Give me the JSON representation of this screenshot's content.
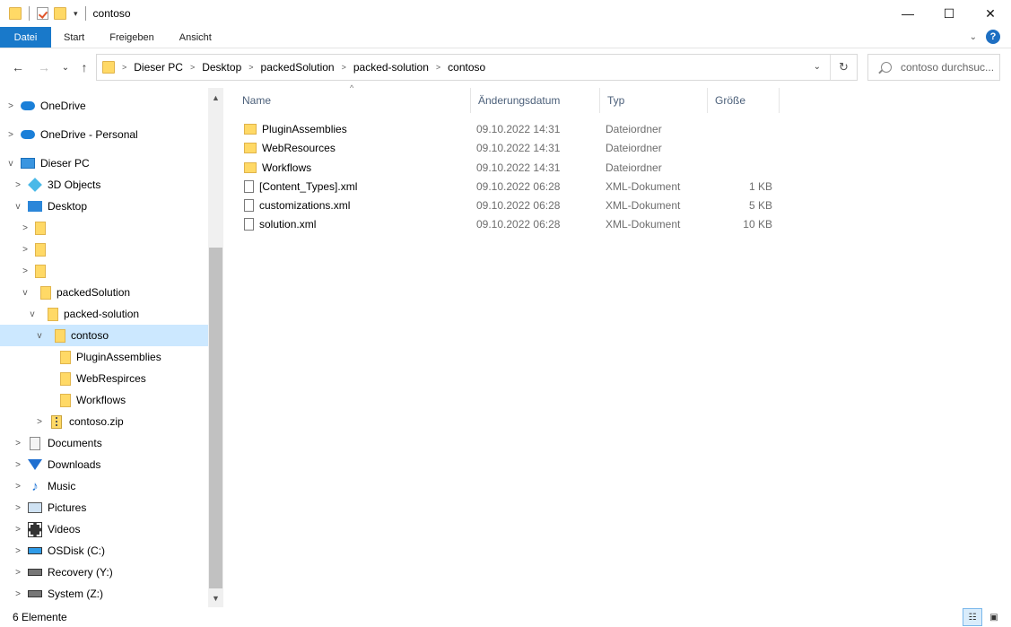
{
  "window": {
    "title": "contoso",
    "minimize_glyph": "—",
    "maximize_glyph": "☐",
    "close_glyph": "✕"
  },
  "ribbon": {
    "tabs": [
      "Datei",
      "Start",
      "Freigeben",
      "Ansicht"
    ],
    "collapse_glyph": "⌄",
    "help_label": "?"
  },
  "nav": {
    "back_glyph": "←",
    "forward_glyph": "→",
    "recent_glyph": "⌄",
    "up_glyph": "↑",
    "breadcrumb": [
      "Dieser PC",
      "Desktop",
      "packedSolution",
      "packed-solution",
      "contoso"
    ],
    "dropdown_glyph": "⌄",
    "refresh_glyph": "↻",
    "search_placeholder": "contoso durchsuc..."
  },
  "sidebar": {
    "items": [
      {
        "label": "OneDrive",
        "icon": "cloud-icon",
        "expand": ">"
      },
      {
        "label": "OneDrive - Personal",
        "icon": "cloud-icon",
        "expand": ">"
      },
      {
        "label": "Dieser PC",
        "icon": "computer-icon",
        "expand": "v"
      },
      {
        "label": "3D Objects",
        "icon": "cube-icon",
        "expand": ">"
      },
      {
        "label": "Desktop",
        "icon": "desktop-icon",
        "expand": "v"
      },
      {
        "label": "",
        "icon": "folder-icon",
        "expand": ">"
      },
      {
        "label": "",
        "icon": "folder-icon",
        "expand": ">"
      },
      {
        "label": "",
        "icon": "folder-icon",
        "expand": ">"
      },
      {
        "label": "packedSolution",
        "icon": "folder-icon",
        "expand": "v"
      },
      {
        "label": "packed-solution",
        "icon": "folder-icon",
        "expand": "v"
      },
      {
        "label": "contoso",
        "icon": "folder-icon",
        "expand": "v"
      },
      {
        "label": "PluginAssemblies",
        "icon": "folder-icon",
        "expand": ""
      },
      {
        "label": "WebRespirces",
        "icon": "folder-icon",
        "expand": ""
      },
      {
        "label": "Workflows",
        "icon": "folder-icon",
        "expand": ""
      },
      {
        "label": "contoso.zip",
        "icon": "zip-icon",
        "expand": ">"
      },
      {
        "label": "Documents",
        "icon": "documents-icon",
        "expand": ">"
      },
      {
        "label": "Downloads",
        "icon": "downloads-icon",
        "expand": ">"
      },
      {
        "label": "Music",
        "icon": "music-icon",
        "expand": ">"
      },
      {
        "label": "Pictures",
        "icon": "pictures-icon",
        "expand": ">"
      },
      {
        "label": "Videos",
        "icon": "videos-icon",
        "expand": ">"
      },
      {
        "label": "OSDisk (C:)",
        "icon": "drive-icon",
        "expand": ">"
      },
      {
        "label": "Recovery (Y:)",
        "icon": "drive-icon",
        "expand": ">"
      },
      {
        "label": "System (Z:)",
        "icon": "drive-icon",
        "expand": ">"
      }
    ],
    "scroll_up_glyph": "▲",
    "scroll_down_glyph": "▼"
  },
  "columns": {
    "name": "Name",
    "date": "Änderungsdatum",
    "type": "Typ",
    "size": "Größe",
    "sort_glyph": "^"
  },
  "files": [
    {
      "name": "PluginAssemblies",
      "date": "09.10.2022 14:31",
      "type": "Dateiordner",
      "size": "",
      "kind": "folder"
    },
    {
      "name": "WebResources",
      "date": "09.10.2022 14:31",
      "type": "Dateiordner",
      "size": "",
      "kind": "folder"
    },
    {
      "name": "Workflows",
      "date": "09.10.2022 14:31",
      "type": "Dateiordner",
      "size": "",
      "kind": "folder"
    },
    {
      "name": "[Content_Types].xml",
      "date": "09.10.2022 06:28",
      "type": "XML-Dokument",
      "size": "1 KB",
      "kind": "xml"
    },
    {
      "name": "customizations.xml",
      "date": "09.10.2022 06:28",
      "type": "XML-Dokument",
      "size": "5 KB",
      "kind": "xml"
    },
    {
      "name": "solution.xml",
      "date": "09.10.2022 06:28",
      "type": "XML-Dokument",
      "size": "10 KB",
      "kind": "xml"
    }
  ],
  "status": {
    "count": "6 Elemente",
    "details_view_glyph": "☷",
    "large_icons_glyph": "▣"
  },
  "colors": {
    "accent": "#1979ca",
    "selection": "#cce8ff",
    "folder": "#ffd966"
  }
}
